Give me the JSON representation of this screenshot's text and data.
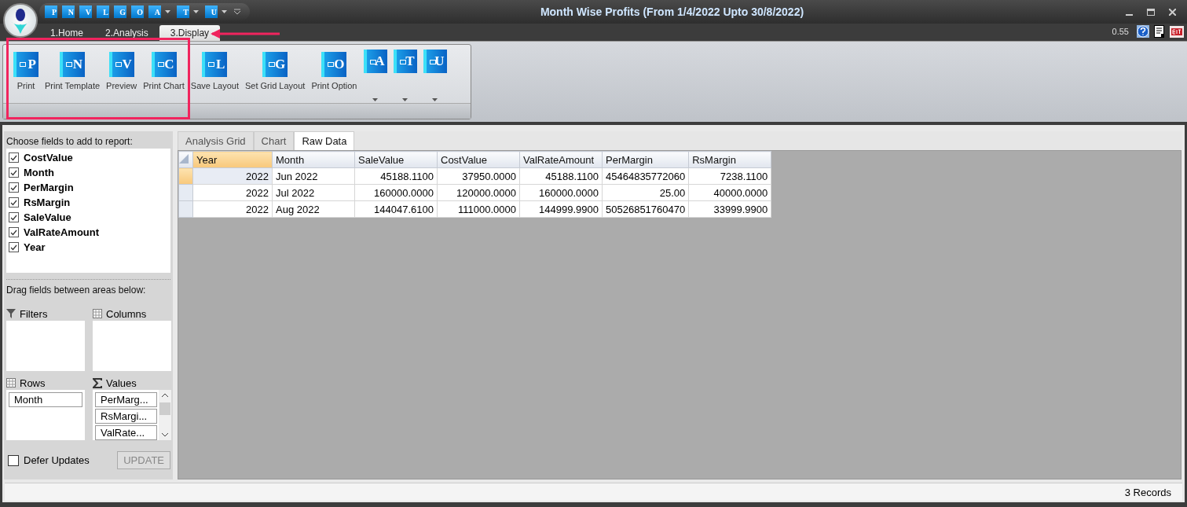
{
  "window": {
    "title": "Month Wise Profits (From 1/4/2022 Upto 30/8/2022)"
  },
  "quick_access": [
    {
      "letter": "P",
      "dropdown": false
    },
    {
      "letter": "N",
      "dropdown": false
    },
    {
      "letter": "V",
      "dropdown": false
    },
    {
      "letter": "L",
      "dropdown": false
    },
    {
      "letter": "G",
      "dropdown": false
    },
    {
      "letter": "O",
      "dropdown": false
    },
    {
      "letter": "A",
      "dropdown": true
    },
    {
      "letter": "T",
      "dropdown": true
    },
    {
      "letter": "U",
      "dropdown": true
    }
  ],
  "ribbon_tabs": [
    {
      "label": "1.Home",
      "selected": false
    },
    {
      "label": "2.Analysis",
      "selected": false
    },
    {
      "label": "3.Display",
      "selected": true
    }
  ],
  "version": "0.55",
  "ribbon_buttons": [
    {
      "letter": "P",
      "label": "Print",
      "dropdown": false
    },
    {
      "letter": "N",
      "label": "Print Template",
      "dropdown": false
    },
    {
      "letter": "V",
      "label": "Preview",
      "dropdown": false
    },
    {
      "letter": "C",
      "label": "Print Chart",
      "dropdown": false
    },
    {
      "letter": "L",
      "label": "Save Layout",
      "dropdown": false
    },
    {
      "letter": "G",
      "label": "Set Grid Layout",
      "dropdown": false
    },
    {
      "letter": "O",
      "label": "Print Option",
      "dropdown": false
    },
    {
      "letter": "A",
      "dropdown": true
    },
    {
      "letter": "T",
      "dropdown": true
    },
    {
      "letter": "U",
      "dropdown": true
    }
  ],
  "field_list": {
    "title": "Choose fields to add to report:",
    "fields": [
      {
        "label": "CostValue",
        "checked": true
      },
      {
        "label": "Month",
        "checked": true
      },
      {
        "label": "PerMargin",
        "checked": true
      },
      {
        "label": "RsMargin",
        "checked": true
      },
      {
        "label": "SaleValue",
        "checked": true
      },
      {
        "label": "ValRateAmount",
        "checked": true
      },
      {
        "label": "Year",
        "checked": true
      }
    ]
  },
  "areas_title": "Drag fields between areas below:",
  "areas": [
    {
      "kind": "filters",
      "label": "Filters"
    },
    {
      "kind": "columns",
      "label": "Columns"
    },
    {
      "kind": "rows",
      "label": "Rows",
      "items": [
        "Month"
      ]
    },
    {
      "kind": "values",
      "label": "Values",
      "items": [
        "PerMarg...",
        "RsMargi...",
        "ValRate..."
      ]
    }
  ],
  "defer_updates": {
    "label": "Defer Updates",
    "checked": false
  },
  "update_button": {
    "label": "UPDATE",
    "disabled": true
  },
  "view_tabs": [
    {
      "label": "Analysis Grid",
      "selected": false
    },
    {
      "label": "Chart",
      "selected": false
    },
    {
      "label": "Raw Data",
      "selected": true
    }
  ],
  "table": {
    "columns": [
      "Year",
      "Month",
      "SaleValue",
      "CostValue",
      "ValRateAmount",
      "PerMargin",
      "RsMargin"
    ],
    "rows": [
      {
        "selected": true,
        "cells": [
          "2022",
          "Jun 2022",
          "45188.1100",
          "37950.0000",
          "45188.1100",
          "45464835772060",
          "7238.1100"
        ]
      },
      {
        "selected": false,
        "cells": [
          "2022",
          "Jul 2022",
          "160000.0000",
          "120000.0000",
          "160000.0000",
          "25.00",
          "40000.0000"
        ]
      },
      {
        "selected": false,
        "cells": [
          "2022",
          "Aug 2022",
          "144047.6100",
          "111000.0000",
          "144999.9900",
          "50526851760470",
          "33999.9900"
        ]
      }
    ]
  },
  "status_bar": "3 Records"
}
